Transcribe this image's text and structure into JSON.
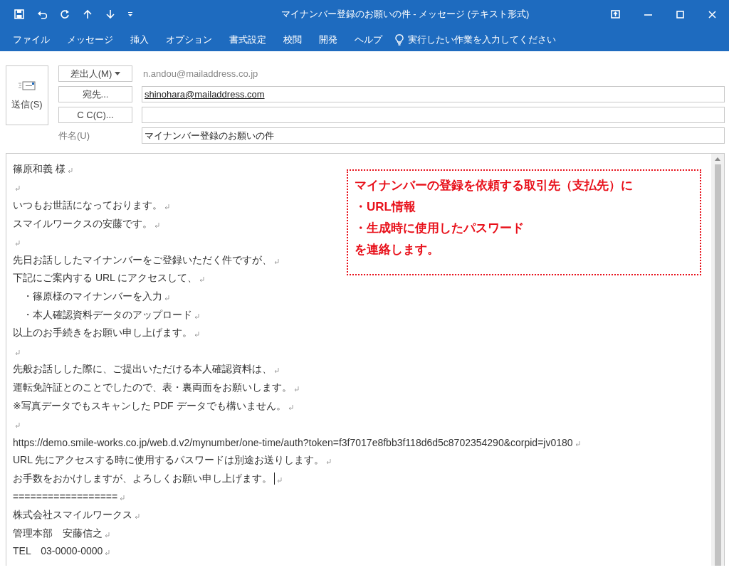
{
  "window": {
    "title": "マイナンバー登録のお願いの件 - メッセージ (テキスト形式)"
  },
  "ribbon_tabs": [
    {
      "label": "ファイル",
      "selected": false
    },
    {
      "label": "メッセージ",
      "selected": false
    },
    {
      "label": "挿入",
      "selected": false
    },
    {
      "label": "オプション",
      "selected": false
    },
    {
      "label": "書式設定",
      "selected": false
    },
    {
      "label": "校閲",
      "selected": false
    },
    {
      "label": "開発",
      "selected": false
    },
    {
      "label": "ヘルプ",
      "selected": false
    }
  ],
  "tell_me": {
    "placeholder": "実行したい作業を入力してください"
  },
  "header": {
    "send_button": "送信(S)",
    "from": {
      "button": "差出人(M)",
      "value": "n.andou@mailaddress.co.jp"
    },
    "to": {
      "button": "宛先...",
      "value": "shinohara@mailaddress.com"
    },
    "cc": {
      "button": "C C(C)..."
    },
    "subject": {
      "label": "件名(U)",
      "value": "マイナンバー登録のお願いの件"
    }
  },
  "body": {
    "lines": [
      {
        "kind": "text",
        "text": "篠原和義 様",
        "cursor": false
      },
      {
        "kind": "blank",
        "cursor": false
      },
      {
        "kind": "text",
        "text": "いつもお世話になっております。",
        "cursor": false
      },
      {
        "kind": "text",
        "text": "スマイルワークスの安藤です。",
        "cursor": false
      },
      {
        "kind": "blank",
        "cursor": false
      },
      {
        "kind": "text",
        "text": "先日お話ししたマイナンバーをご登録いただく件ですが、",
        "cursor": false
      },
      {
        "kind": "text",
        "text": "下記にご案内する URL にアクセスして、",
        "cursor": false
      },
      {
        "kind": "text",
        "text": "　・篠原様のマイナンバーを入力",
        "cursor": false
      },
      {
        "kind": "text",
        "text": "　・本人確認資料データのアップロード",
        "cursor": false
      },
      {
        "kind": "text",
        "text": "以上のお手続きをお願い申し上げます。",
        "cursor": false
      },
      {
        "kind": "blank",
        "cursor": false
      },
      {
        "kind": "text",
        "text": "先般お話しした際に、ご提出いただける本人確認資料は、",
        "cursor": false
      },
      {
        "kind": "text",
        "text": "運転免許証とのことでしたので、表・裏両面をお願いします。",
        "cursor": false
      },
      {
        "kind": "text",
        "text": "※写真データでもスキャンした PDF データでも構いません。",
        "cursor": false
      },
      {
        "kind": "blank",
        "cursor": false
      },
      {
        "kind": "text",
        "text": "https://demo.smile-works.co.jp/web.d.v2/mynumber/one-time/auth?token=f3f7017e8fbb3f118d6d5c8702354290&corpid=jv0180",
        "cursor": false
      },
      {
        "kind": "text",
        "text": "URL 先にアクセスする時に使用するパスワードは別途お送りします。",
        "cursor": false
      },
      {
        "kind": "text",
        "text": "お手数をおかけしますが、よろしくお願い申し上げます。",
        "cursor": true
      },
      {
        "kind": "text",
        "text": "==================",
        "cursor": false
      },
      {
        "kind": "text",
        "text": "株式会社スマイルワークス",
        "cursor": false
      },
      {
        "kind": "text",
        "text": "管理本部　安藤信之",
        "cursor": false
      },
      {
        "kind": "text",
        "text": "TEL　03-0000-0000",
        "cursor": false
      }
    ]
  },
  "callout": {
    "lines": [
      "マイナンバーの登録を依頼する取引先（支払先）に",
      "・URL情報",
      "・生成時に使用したパスワード",
      "を連絡します。"
    ]
  }
}
